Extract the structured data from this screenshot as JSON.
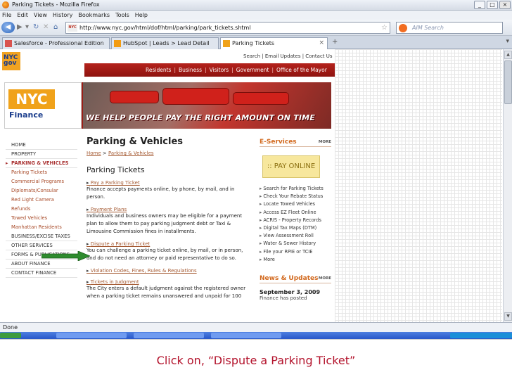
{
  "window": {
    "title": "Parking Tickets - Mozilla Firefox"
  },
  "menu": [
    "File",
    "Edit",
    "View",
    "History",
    "Bookmarks",
    "Tools",
    "Help"
  ],
  "nav": {
    "url": "http://www.nyc.gov/html/dof/html/parking/park_tickets.shtml",
    "search_placeholder": "AIM Search"
  },
  "tabs": [
    {
      "label": "Salesforce - Professional Edition",
      "active": false
    },
    {
      "label": "HubSpot | Leads > Lead Detail",
      "active": false
    },
    {
      "label": "Parking Tickets",
      "active": true
    }
  ],
  "page": {
    "logo_text": "NYC gov",
    "top_links": "Search  |  Email Updates  |  Contact Us",
    "main_nav": [
      "Residents",
      "Business",
      "Visitors",
      "Government",
      "Office of the Mayor"
    ],
    "banner": {
      "brand": "NYC",
      "brand_sub": "Finance",
      "slogan": "WE HELP PEOPLE PAY THE RIGHT AMOUNT ON TIME"
    },
    "left_nav": [
      {
        "label": "HOME",
        "type": "item"
      },
      {
        "label": "PROPERTY",
        "type": "item"
      },
      {
        "label": "PARKING & VEHICLES",
        "type": "active"
      },
      {
        "label": "Parking Tickets",
        "type": "sub"
      },
      {
        "label": "Commercial Programs",
        "type": "sub"
      },
      {
        "label": "Diplomats/Consular",
        "type": "sub"
      },
      {
        "label": "Red Light Camera",
        "type": "sub"
      },
      {
        "label": "Refunds",
        "type": "sub"
      },
      {
        "label": "Towed Vehicles",
        "type": "sub"
      },
      {
        "label": "Manhattan Residents",
        "type": "sub"
      },
      {
        "label": "BUSINESS/EXCISE TAXES",
        "type": "item"
      },
      {
        "label": "OTHER SERVICES",
        "type": "item"
      },
      {
        "label": "FORMS & PUBLICATIONS",
        "type": "item"
      },
      {
        "label": "ABOUT FINANCE",
        "type": "item"
      },
      {
        "label": "CONTACT FINANCE",
        "type": "item"
      }
    ],
    "heading": "Parking & Vehicles",
    "breadcrumb": {
      "home": "Home",
      "sep": " > ",
      "current": "Parking & Vehicles"
    },
    "subheading": "Parking Tickets",
    "sections": [
      {
        "link": "Pay a Parking Ticket",
        "text": "Finance accepts payments online, by phone, by mail, and in person."
      },
      {
        "link": "Payment Plans",
        "text": "Individuals and business owners may be eligible for a payment plan to allow them to pay parking judgment debt or Taxi & Limousine Commission fines in installments."
      },
      {
        "link": "Dispute a Parking Ticket",
        "text": "You can challenge a parking ticket online, by mail, or in person, and do not need an attorney or paid representative to do so."
      },
      {
        "link": "Violation Codes, Fines, Rules & Regulations",
        "text": ""
      },
      {
        "link": "Tickets in Judgment",
        "text": "The City enters a default judgment against the registered owner when a parking ticket remains unanswered and unpaid for 100"
      }
    ],
    "eservices": {
      "title": "E-Services",
      "more": "MORE",
      "pay_online": ":: PAY ONLINE",
      "items": [
        "Search for Parking Tickets",
        "Check Your Rebate Status",
        "Locate Towed Vehicles",
        "Access EZ Fleet Online",
        "ACRIS - Property Records",
        "Digital Tax Maps (DTM)",
        "View Assessment Roll",
        "Water & Sewer History",
        "File your RPIE or TCIE",
        "More"
      ]
    },
    "news": {
      "title": "News & Updates",
      "more": "MORE",
      "date": "September 3, 2009",
      "body": "Finance has posted"
    }
  },
  "status": "Done",
  "caption": "Click on, “Dispute a Parking Ticket”",
  "colors": {
    "nyc_red": "#a8201a",
    "link": "#a55a32",
    "eservices": "#d2691e",
    "arrow_green": "#2e8b2e",
    "caption": "#b3122b"
  }
}
